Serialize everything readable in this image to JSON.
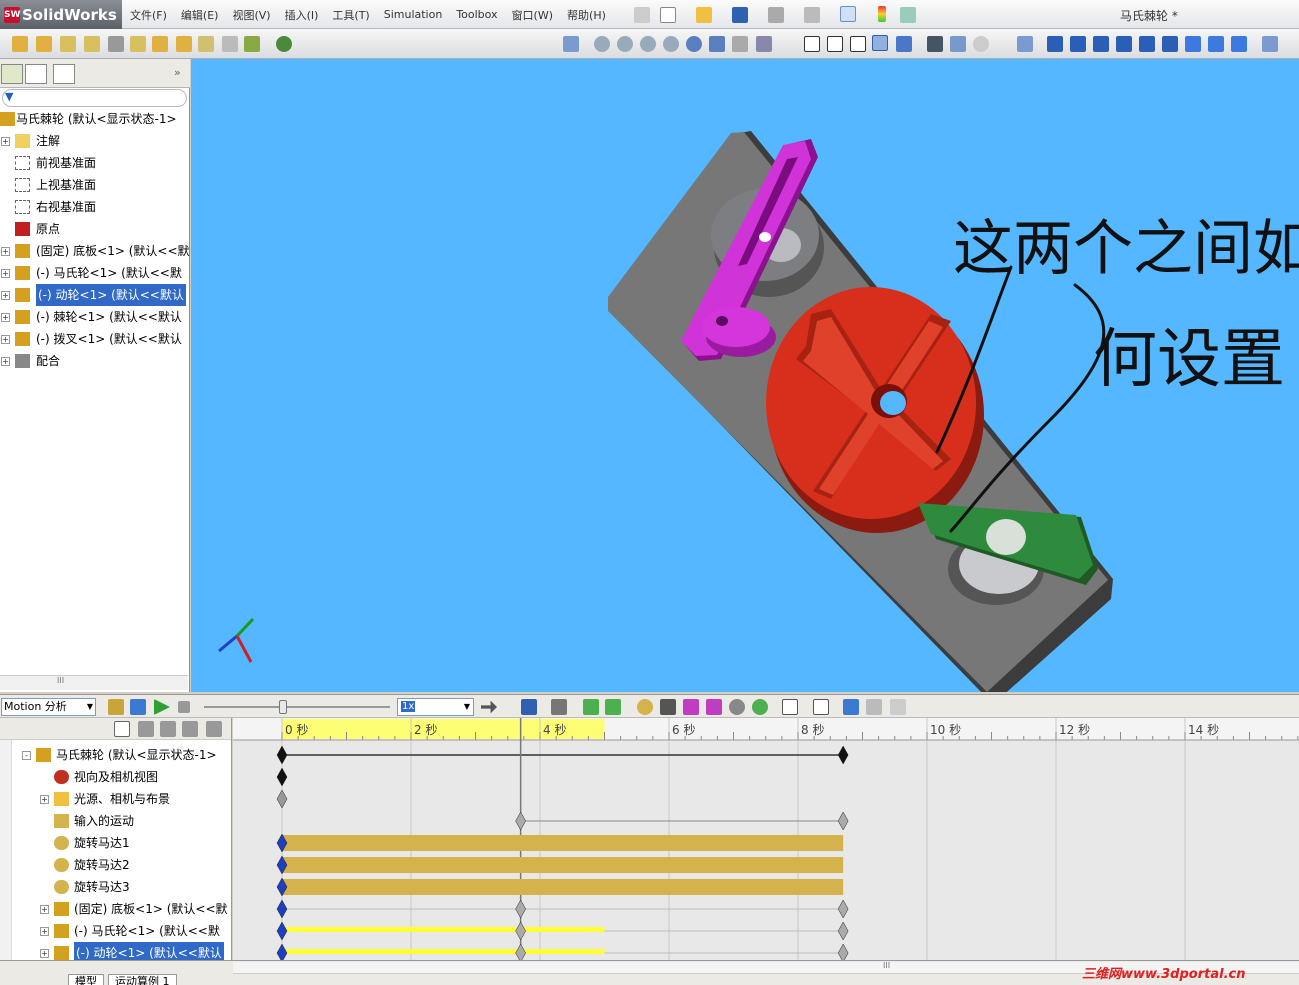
{
  "app": {
    "logo_text": "SolidWorks",
    "logo_mark": "SW",
    "document_title": "马氏棘轮 *"
  },
  "menu": [
    "文件(F)",
    "编辑(E)",
    "视图(V)",
    "插入(I)",
    "工具(T)",
    "Simulation",
    "Toolbox",
    "窗口(W)",
    "帮助(H)"
  ],
  "feature_tree": {
    "items": [
      {
        "label": "马氏棘轮  (默认<显示状态-1>",
        "icon": "assembly-icon",
        "expander": ""
      },
      {
        "label": "注解",
        "icon": "annotation-icon",
        "expander": "+"
      },
      {
        "label": "前视基准面",
        "icon": "plane-icon",
        "expander": ""
      },
      {
        "label": "上视基准面",
        "icon": "plane-icon",
        "expander": ""
      },
      {
        "label": "右视基准面",
        "icon": "plane-icon",
        "expander": ""
      },
      {
        "label": "原点",
        "icon": "origin-icon",
        "expander": ""
      },
      {
        "label": "(固定) 底板<1> (默认<<默",
        "icon": "part-icon",
        "expander": "+"
      },
      {
        "label": "(-) 马氏轮<1> (默认<<默",
        "icon": "part-icon",
        "expander": "+"
      },
      {
        "label": "(-) 动轮<1> (默认<<默认",
        "icon": "part-icon",
        "expander": "+",
        "selected": true
      },
      {
        "label": "(-) 棘轮<1> (默认<<默认",
        "icon": "part-icon",
        "expander": "+"
      },
      {
        "label": "(-) 拨叉<1> (默认<<默认",
        "icon": "part-icon",
        "expander": "+"
      },
      {
        "label": "配合",
        "icon": "mates-icon",
        "expander": "+"
      }
    ],
    "scroll_label": "III"
  },
  "annotation_handwriting": [
    "这两个之间如",
    "何设置"
  ],
  "motion": {
    "study_type": "Motion 分析",
    "playback_speed": "1x",
    "timeline_ticks": [
      "0 秒",
      "2 秒",
      "4 秒",
      "6 秒",
      "8 秒",
      "10 秒",
      "12 秒",
      "14 秒"
    ],
    "tree_items": [
      {
        "label": "马氏棘轮  (默认<显示状态-1>",
        "icon": "assembly-icon",
        "expander": "-"
      },
      {
        "label": "视向及相机视图",
        "icon": "camera-icon",
        "expander": ""
      },
      {
        "label": "光源、相机与布景",
        "icon": "light-icon",
        "expander": "+"
      },
      {
        "label": "输入的运动",
        "icon": "motion-icon",
        "expander": ""
      },
      {
        "label": "旋转马达1",
        "icon": "motor-icon",
        "expander": ""
      },
      {
        "label": "旋转马达2",
        "icon": "motor-icon",
        "expander": ""
      },
      {
        "label": "旋转马达3",
        "icon": "motor-icon",
        "expander": ""
      },
      {
        "label": "(固定) 底板<1> (默认<<默",
        "icon": "part-icon",
        "expander": "+"
      },
      {
        "label": "(-) 马氏轮<1> (默认<<默",
        "icon": "part-icon",
        "expander": "+"
      },
      {
        "label": "(-) 动轮<1> (默认<<默认",
        "icon": "part-icon",
        "expander": "+",
        "selected": true
      }
    ],
    "timeline_scroll_label": "III",
    "tabs": [
      "模型",
      "运动算例 1"
    ]
  },
  "watermark": "三维网www.3dportal.cn",
  "colors": {
    "viewport_bg": "#55b7ff",
    "selection": "#3169c6",
    "motor_bar": "#d4b24c",
    "keyframe_blue": "#1f3fbf",
    "playhead_region": "#ffff66",
    "wheel_red": "#d42a1a",
    "crank_purple": "#c020c8",
    "fork_green": "#2f8a3a",
    "plate_gray": "#6a6a6a"
  }
}
